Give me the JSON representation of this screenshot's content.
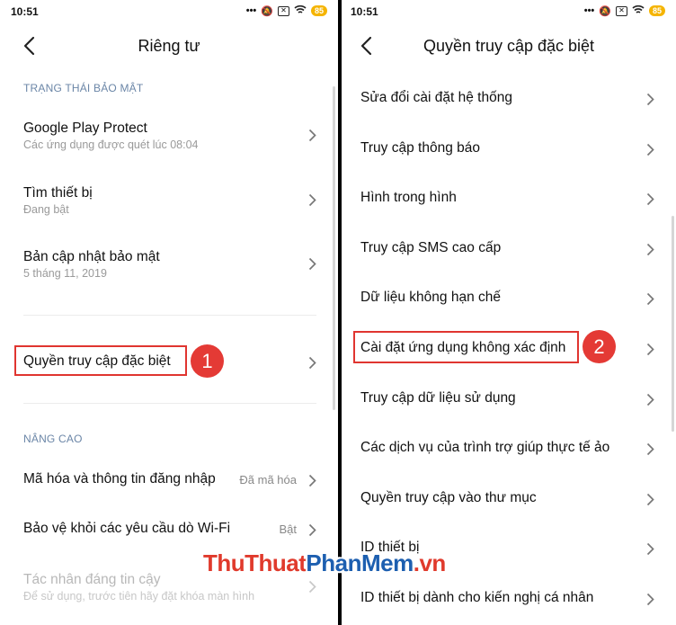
{
  "colors": {
    "accent_red": "#e03530",
    "section_blue": "#6b86a7",
    "battery": "#f5b400",
    "watermark_red": "#e03a2c",
    "watermark_blue": "#1d5fb0"
  },
  "left": {
    "status": {
      "time": "10:51",
      "battery": "85"
    },
    "title": "Riêng tư",
    "section_security": "TRẠNG THÁI BẢO MẬT",
    "items": [
      {
        "label": "Google Play Protect",
        "sub": "Các ứng dụng được quét lúc 08:04"
      },
      {
        "label": "Tìm thiết bị",
        "sub": "Đang bật"
      },
      {
        "label": "Bản cập nhật bảo mật",
        "sub": "5 tháng 11, 2019"
      },
      {
        "label": "Quyền truy cập đặc biệt"
      }
    ],
    "badge": "1",
    "section_advanced": "NÂNG CAO",
    "advanced_items": [
      {
        "label": "Mã hóa và thông tin đăng nhập",
        "value": "Đã mã hóa"
      },
      {
        "label": "Bảo vệ khỏi các yêu cầu dò Wi-Fi",
        "value": "Bật"
      },
      {
        "label": "Tác nhân đáng tin cậy",
        "sub": "Để sử dụng, trước tiên hãy đặt khóa màn hình"
      }
    ]
  },
  "right": {
    "status": {
      "time": "10:51",
      "battery": "85"
    },
    "title": "Quyền truy cập đặc biệt",
    "items": [
      "Sửa đổi cài đặt hệ thống",
      "Truy cập thông báo",
      "Hình trong hình",
      "Truy cập SMS cao cấp",
      "Dữ liệu không hạn chế",
      "Cài đặt ứng dụng không xác định",
      "Truy cập dữ liệu sử dụng",
      "Các dịch vụ của trình trợ giúp thực tế ảo",
      "Quyền truy cập vào thư mục",
      "ID thiết bị",
      "ID thiết bị dành cho kiến nghị cá nhân"
    ],
    "badge": "2"
  },
  "watermark": {
    "part1": "ThuThuat",
    "part2": "PhanMem",
    "part3": ".vn"
  }
}
